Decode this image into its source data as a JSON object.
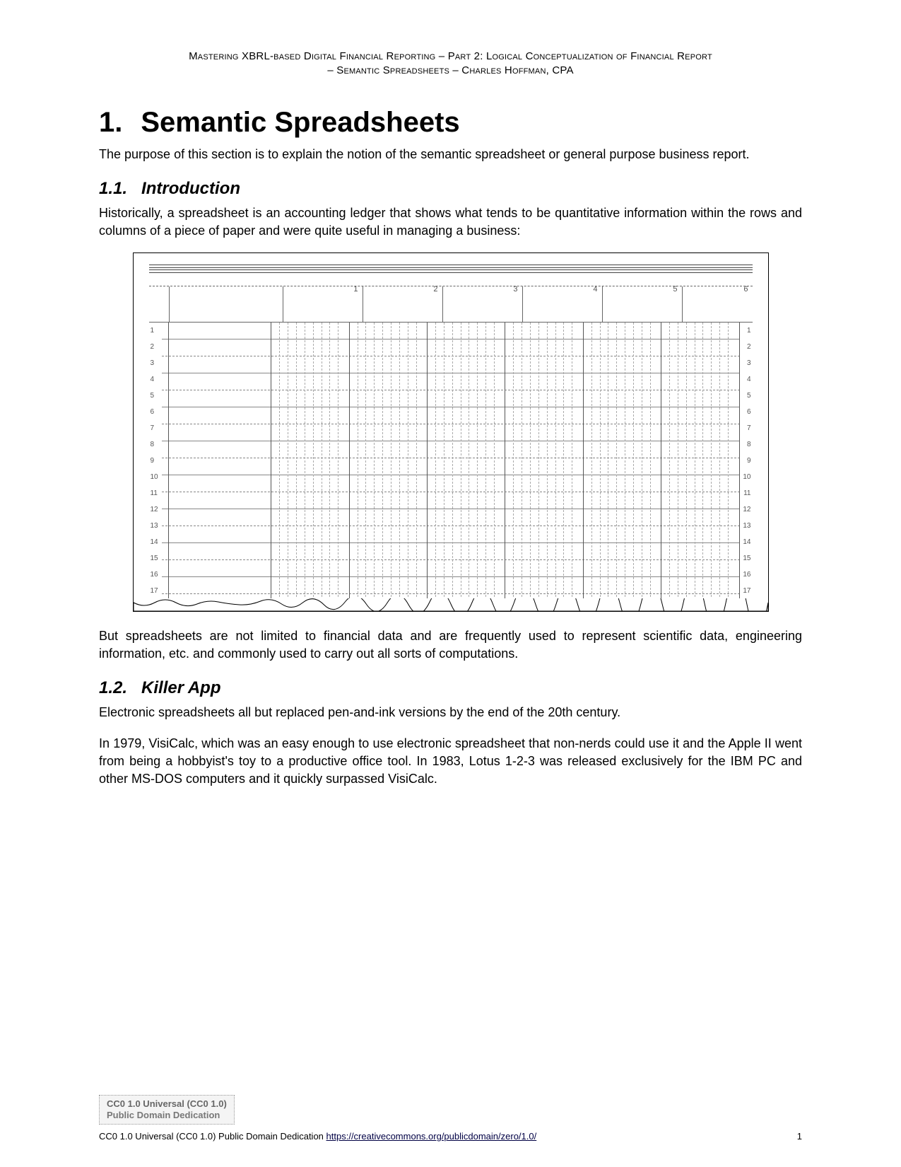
{
  "header": {
    "line1": "Mastering XBRL-based Digital Financial Reporting – Part 2: Logical Conceptualization of Financial Report",
    "line2": "– Semantic Spreadsheets – Charles Hoffman, CPA"
  },
  "section": {
    "number": "1.",
    "title": "Semantic Spreadsheets",
    "intro": "The purpose of this section is to explain the notion of the semantic spreadsheet or general purpose business report."
  },
  "sub1": {
    "number": "1.1.",
    "title": "Introduction",
    "p1": "Historically, a spreadsheet is an accounting ledger that shows what tends to be quantitative information within the rows and columns of a piece of paper and were quite useful in managing a business:",
    "p2": "But spreadsheets are not limited to financial data and are frequently used to represent scientific data, engineering information, etc. and commonly used to carry out all sorts of computations."
  },
  "sub2": {
    "number": "1.2.",
    "title": "Killer App",
    "p1": "Electronic spreadsheets all but replaced pen-and-ink versions by the end of the 20th century.",
    "p2": "In 1979, VisiCalc, which was an easy enough to use electronic spreadsheet that non-nerds could use it and the Apple II went from being a hobbyist's toy to a productive office tool. In 1983, Lotus 1-2-3 was released exclusively for the IBM PC and other MS-DOS computers and it quickly surpassed VisiCalc."
  },
  "ledger": {
    "col_numbers": [
      "1",
      "2",
      "3",
      "4",
      "5",
      "6"
    ],
    "rows_left": [
      "1",
      "2",
      "3",
      "4",
      "5",
      "6",
      "7",
      "8",
      "9",
      "10",
      "11",
      "12",
      "13",
      "14",
      "15",
      "16",
      "17"
    ],
    "rows_right": [
      "1",
      "2",
      "3",
      "4",
      "5",
      "6",
      "7",
      "8",
      "9",
      "10",
      "11",
      "12",
      "13",
      "14",
      "15",
      "16",
      "17"
    ]
  },
  "license": {
    "box_line1": "CC0 1.0 Universal (CC0 1.0)",
    "box_line2": "Public Domain Dedication",
    "footer_text": "CC0 1.0 Universal (CC0 1.0) Public Domain Dedication ",
    "footer_link": "https://creativecommons.org/publicdomain/zero/1.0/",
    "page_number": "1"
  }
}
